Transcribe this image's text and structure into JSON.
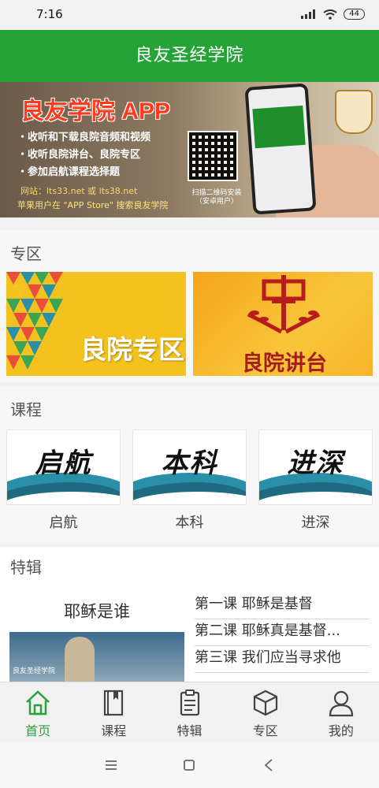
{
  "status": {
    "time": "7:16",
    "battery": "44"
  },
  "app": {
    "title": "良友圣经学院"
  },
  "banner": {
    "title": "良友学院 APP",
    "lines": [
      "・收听和下载良院音频和视频",
      "・收听良院讲台、良院专区",
      "・参加启航课程选择题"
    ],
    "site": "网站：lts33.net 或 lts38.net",
    "bottom": "苹果用户在 \"APP Store\" 搜索良友学院",
    "qr_note": "扫描二维码安装（安卓用户）"
  },
  "sections": {
    "zone": {
      "title": "专区",
      "tiles": [
        "良院专区",
        "良院讲台"
      ]
    },
    "courses": {
      "title": "课程",
      "items": [
        {
          "word": "启航",
          "caption": "启航"
        },
        {
          "word": "本科",
          "caption": "本科"
        },
        {
          "word": "进深",
          "caption": "进深"
        }
      ]
    },
    "features": {
      "title": "特辑",
      "feature_title": "耶稣是谁",
      "feature_logo": "良友圣经学院",
      "list": [
        "第一课 耶稣是基督",
        "第二课 耶稣真是基督...",
        "第三课 我们应当寻求他"
      ]
    }
  },
  "tabs": [
    {
      "label": "首页",
      "icon": "home-icon",
      "active": true
    },
    {
      "label": "课程",
      "icon": "book-icon",
      "active": false
    },
    {
      "label": "特辑",
      "icon": "clipboard-icon",
      "active": false
    },
    {
      "label": "专区",
      "icon": "cube-icon",
      "active": false
    },
    {
      "label": "我的",
      "icon": "user-icon",
      "active": false
    }
  ],
  "colors": {
    "primary": "#26a336",
    "accent_yellow": "#f6c325"
  }
}
